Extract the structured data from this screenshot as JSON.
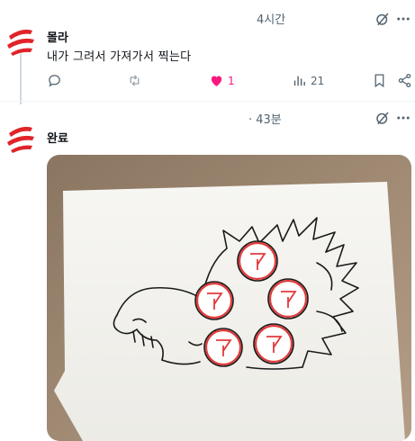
{
  "post1": {
    "author": "몰라",
    "text": "내가 그려서 가져가서 찍는다",
    "time": "4시간",
    "actions": {
      "reply_count": "",
      "retweet_count": "",
      "like_count": "1",
      "view_count": "21"
    }
  },
  "post2": {
    "author": "완료",
    "time": "· 43분"
  },
  "colors": {
    "like_active": "#f91880",
    "muted": "#536471",
    "avatar_red": "#e0242a",
    "stamp_red": "#e23a3a"
  }
}
